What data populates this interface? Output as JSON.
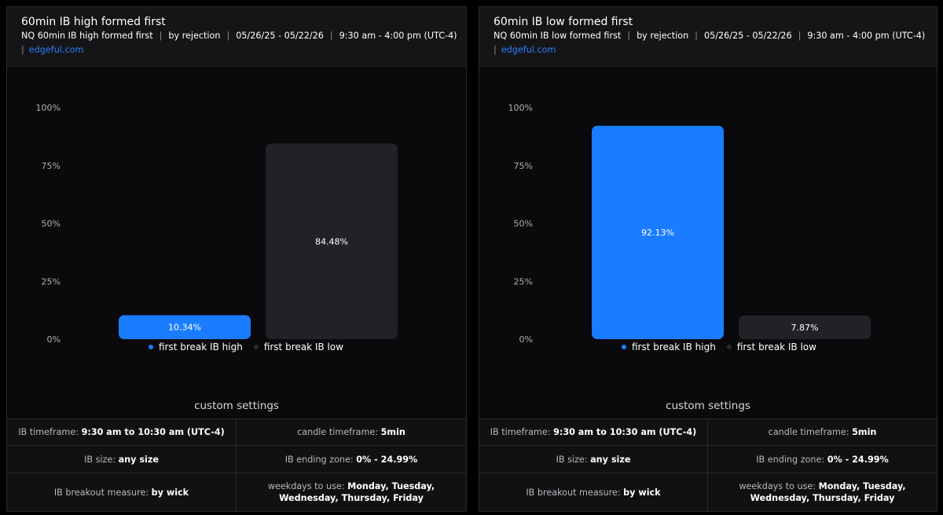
{
  "colors": {
    "high": "#1a7dff",
    "low": "#222226",
    "panel": "#0a0a0c",
    "accent_link": "#2a7fff"
  },
  "panels": [
    {
      "title": "60min IB high formed first",
      "subtitle": {
        "name": "NQ 60min IB high formed first",
        "method": "by rejection",
        "dates": "05/26/25 - 05/22/26",
        "hours": "9:30 am - 4:00 pm (UTC-4)"
      },
      "link": "edgeful.com",
      "legend": [
        "first break IB high",
        "first break IB low"
      ],
      "settings_title": "custom settings",
      "settings": {
        "ib_timeframe_label": "IB timeframe:",
        "ib_timeframe": "9:30 am to 10:30 am (UTC-4)",
        "candle_timeframe_label": "candle timeframe:",
        "candle_timeframe": "5min",
        "ib_size_label": "IB size:",
        "ib_size": "any size",
        "ib_ending_zone_label": "IB ending zone:",
        "ib_ending_zone": "0% - 24.99%",
        "breakout_label": "IB breakout measure:",
        "breakout": "by wick",
        "weekdays_label": "weekdays to use:",
        "weekdays": "Monday, Tuesday, Wednesday, Thursday, Friday"
      }
    },
    {
      "title": "60min IB low formed first",
      "subtitle": {
        "name": "NQ 60min IB low formed first",
        "method": "by rejection",
        "dates": "05/26/25 - 05/22/26",
        "hours": "9:30 am - 4:00 pm (UTC-4)"
      },
      "link": "edgeful.com",
      "legend": [
        "first break IB high",
        "first break IB low"
      ],
      "settings_title": "custom settings",
      "settings": {
        "ib_timeframe_label": "IB timeframe:",
        "ib_timeframe": "9:30 am to 10:30 am (UTC-4)",
        "candle_timeframe_label": "candle timeframe:",
        "candle_timeframe": "5min",
        "ib_size_label": "IB size:",
        "ib_size": "any size",
        "ib_ending_zone_label": "IB ending zone:",
        "ib_ending_zone": "0% - 24.99%",
        "breakout_label": "IB breakout measure:",
        "breakout": "by wick",
        "weekdays_label": "weekdays to use:",
        "weekdays": "Monday, Tuesday, Wednesday, Thursday, Friday"
      }
    }
  ],
  "chart_data": [
    {
      "type": "bar",
      "categories": [
        "first break IB high",
        "first break IB low"
      ],
      "values": [
        10.34,
        84.48
      ],
      "value_labels": [
        "10.34%",
        "84.48%"
      ],
      "yticks": [
        "0%",
        "25%",
        "50%",
        "75%",
        "100%"
      ],
      "ylim": [
        0,
        100
      ],
      "grid": false,
      "legend": "bottom"
    },
    {
      "type": "bar",
      "categories": [
        "first break IB high",
        "first break IB low"
      ],
      "values": [
        92.13,
        7.87
      ],
      "value_labels": [
        "92.13%",
        "7.87%"
      ],
      "yticks": [
        "0%",
        "25%",
        "50%",
        "75%",
        "100%"
      ],
      "ylim": [
        0,
        100
      ],
      "grid": false,
      "legend": "bottom"
    }
  ]
}
